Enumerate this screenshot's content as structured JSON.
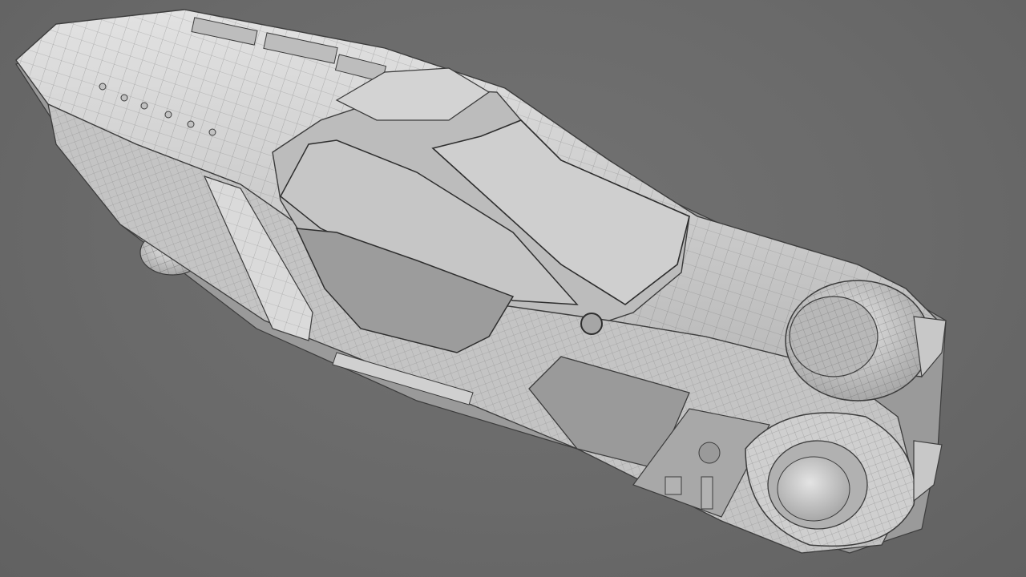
{
  "viewport": {
    "background": "#6b6b6b",
    "shading": "clay-wireframe",
    "subject": "vehicle-model"
  },
  "palette": {
    "body": "#d6d6d6",
    "body_shadow": "#a9a9a9",
    "body_dark": "#8c8c8c",
    "glass": "#c9c9c9",
    "wire": "#3c3c3c"
  }
}
